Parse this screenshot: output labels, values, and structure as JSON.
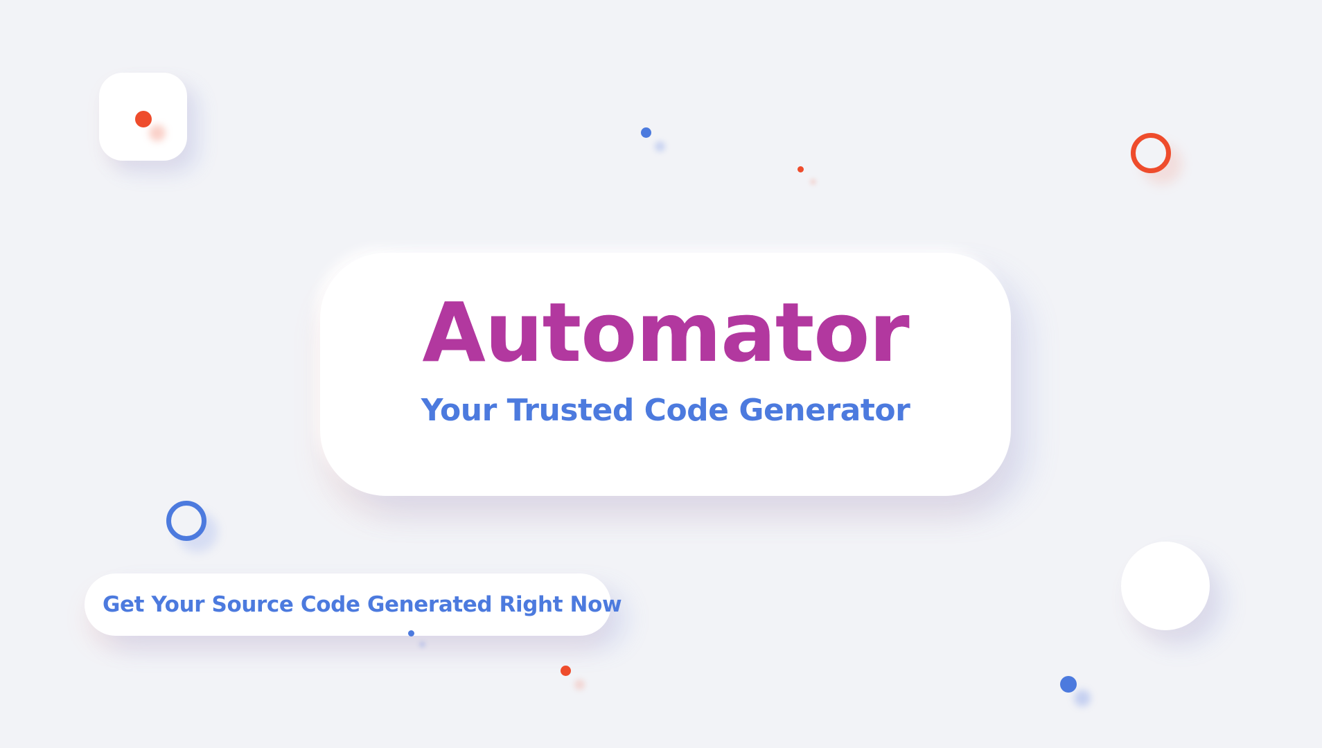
{
  "hero": {
    "title": "Automator",
    "subtitle": "Your Trusted Code Generator"
  },
  "cta": {
    "label": "Get Your Source Code Generated Right Now"
  },
  "colors": {
    "background": "#f2f3f7",
    "card": "#ffffff",
    "title": "#b2389f",
    "accent_blue": "#4c7ade",
    "accent_red": "#ee4c2c"
  },
  "decorations": [
    "rounded-square",
    "white-circle",
    "blue-ring",
    "red-ring",
    "blue-dot",
    "red-dot"
  ]
}
